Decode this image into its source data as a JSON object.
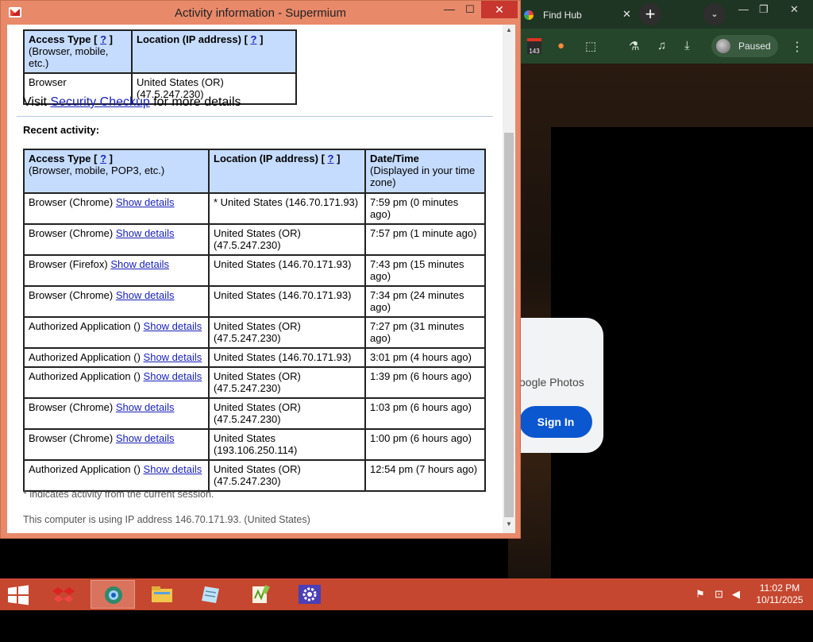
{
  "browser": {
    "tab_title": "Find Hub",
    "tab_close": "✕",
    "new_tab": "+",
    "tab_search": "⌄",
    "minimize": "—",
    "maximize": "❐",
    "close": "✕",
    "extension_badge": "143",
    "profile_status": "Paused",
    "menu": "⋮",
    "photos_text": "oogle Photos",
    "sign_in": "Sign In"
  },
  "popup": {
    "title": "Activity information - Supermium",
    "minimize": "—",
    "maximize": "☐",
    "close": "✕",
    "current_table": {
      "headers": {
        "access_type": "Access Type [",
        "access_type_help": "?",
        "access_type_close": "]",
        "access_type_sub": "(Browser, mobile, etc.)",
        "location": "Location (IP address) [",
        "location_help": "?",
        "location_close": "]"
      },
      "row": {
        "access": "Browser",
        "location": "United States (OR) (47.5.247.230)"
      }
    },
    "visit": {
      "prefix": "Visit ",
      "link": "Security Checkup",
      "suffix": " for more details"
    },
    "recent_heading": "Recent activity:",
    "recent_table": {
      "headers": {
        "access_type": "Access Type [",
        "access_type_help": "?",
        "access_type_close": "]",
        "access_type_sub": "(Browser, mobile, POP3, etc.)",
        "location": "Location (IP address) [",
        "location_help": "?",
        "location_close": "]",
        "datetime": "Date/Time",
        "datetime_sub": "(Displayed in your time zone)"
      },
      "show_details": "Show details",
      "rows": [
        {
          "access": "Browser (Chrome)",
          "location": "* United States (146.70.171.93)",
          "time": "7:59 pm (0 minutes ago)"
        },
        {
          "access": "Browser (Chrome)",
          "location": "United States (OR) (47.5.247.230)",
          "time": "7:57 pm (1 minute ago)"
        },
        {
          "access": "Browser (Firefox)",
          "location": "United States (146.70.171.93)",
          "time": "7:43 pm (15 minutes ago)"
        },
        {
          "access": "Browser (Chrome)",
          "location": "United States (146.70.171.93)",
          "time": "7:34 pm (24 minutes ago)"
        },
        {
          "access": "Authorized Application ()",
          "location": "United States (OR) (47.5.247.230)",
          "time": "7:27 pm (31 minutes ago)"
        },
        {
          "access": "Authorized Application ()",
          "location": "United States (146.70.171.93)",
          "time": "3:01 pm (4 hours ago)"
        },
        {
          "access": "Authorized Application ()",
          "location": "United States (OR) (47.5.247.230)",
          "time": "1:39 pm (6 hours ago)"
        },
        {
          "access": "Browser (Chrome)",
          "location": "United States (OR) (47.5.247.230)",
          "time": "1:03 pm (6 hours ago)"
        },
        {
          "access": "Browser (Chrome)",
          "location": "United States (193.106.250.114)",
          "time": "1:00 pm (6 hours ago)"
        },
        {
          "access": "Authorized Application ()",
          "location": "United States (OR) (47.5.247.230)",
          "time": "12:54 pm (7 hours ago)"
        }
      ]
    },
    "session_note": "* indicates activity from the current session.",
    "ip_note": "This computer is using IP address 146.70.171.93. (United States)"
  },
  "taskbar": {
    "time": "11:02 PM",
    "date": "10/11/2025",
    "active_index": 1,
    "apps": [
      "dropbox-app",
      "browser-app",
      "file-explorer-app",
      "notepad-app",
      "notepad-plus-plus-app",
      "settings-app"
    ]
  }
}
